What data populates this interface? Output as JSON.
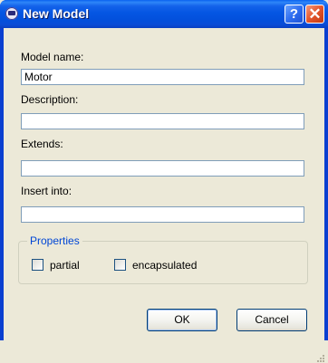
{
  "window": {
    "title": "New Model",
    "help_label": "?",
    "close_label": "✕"
  },
  "form": {
    "model_name_label": "Model name:",
    "model_name_value": "Motor",
    "description_label": "Description:",
    "description_value": "",
    "extends_label": "Extends:",
    "extends_value": "",
    "insert_into_label": "Insert into:",
    "insert_into_value": ""
  },
  "properties": {
    "legend": "Properties",
    "partial_label": "partial",
    "partial_checked": false,
    "encapsulated_label": "encapsulated",
    "encapsulated_checked": false
  },
  "buttons": {
    "ok_label": "OK",
    "cancel_label": "Cancel"
  },
  "colors": {
    "title_bar": "#0a58e6",
    "dialog_face": "#ece9d8",
    "group_legend": "#0046d5",
    "close_button": "#e3542a"
  }
}
